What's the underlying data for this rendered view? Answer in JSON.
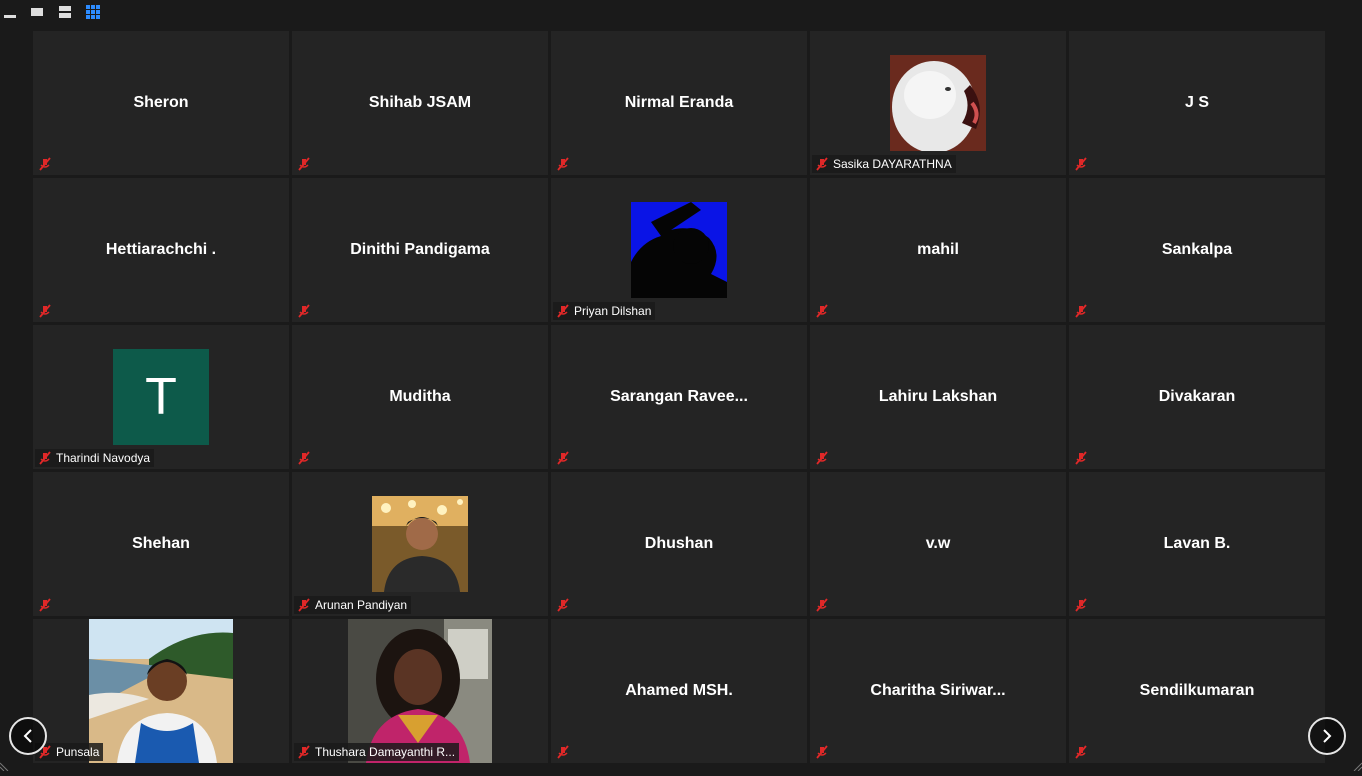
{
  "toolbar": {
    "icons": [
      "minimize-icon",
      "speaker-view-icon",
      "strip-view-icon",
      "gallery-view-icon"
    ],
    "active_view": "gallery",
    "accent": "#2d8cff"
  },
  "participants": [
    {
      "name": "Sheron"
    },
    {
      "name": "Shihab JSAM"
    },
    {
      "name": "Nirmal Eranda"
    },
    {
      "name": "Sasika DAYARATHNA"
    },
    {
      "name": "J S"
    },
    {
      "name": "Hettiarachchi ."
    },
    {
      "name": "Dinithi Pandigama"
    },
    {
      "name": "Priyan Dilshan"
    },
    {
      "name": "mahil"
    },
    {
      "name": "Sankalpa"
    },
    {
      "name": "Tharindi Navodya",
      "avatar_letter": "T"
    },
    {
      "name": "Muditha"
    },
    {
      "name": "Sarangan  Ravee..."
    },
    {
      "name": "Lahiru Lakshan"
    },
    {
      "name": "Divakaran"
    },
    {
      "name": "Shehan"
    },
    {
      "name": "Arunan Pandiyan"
    },
    {
      "name": "Dhushan"
    },
    {
      "name": "v.w"
    },
    {
      "name": "Lavan B."
    },
    {
      "name": "Punsala"
    },
    {
      "name": "Thushara  Damayanthi R..."
    },
    {
      "name": "Ahamed MSH."
    },
    {
      "name": "Charitha  Siriwar..."
    },
    {
      "name": "Sendilkumaran"
    }
  ],
  "colors": {
    "tile_bg": "#242424",
    "muted_icon": "#e02828",
    "avatar_green": "#0d5a4a"
  },
  "navigation": {
    "prev_icon": "chevron-left-icon",
    "next_icon": "chevron-right-icon"
  }
}
